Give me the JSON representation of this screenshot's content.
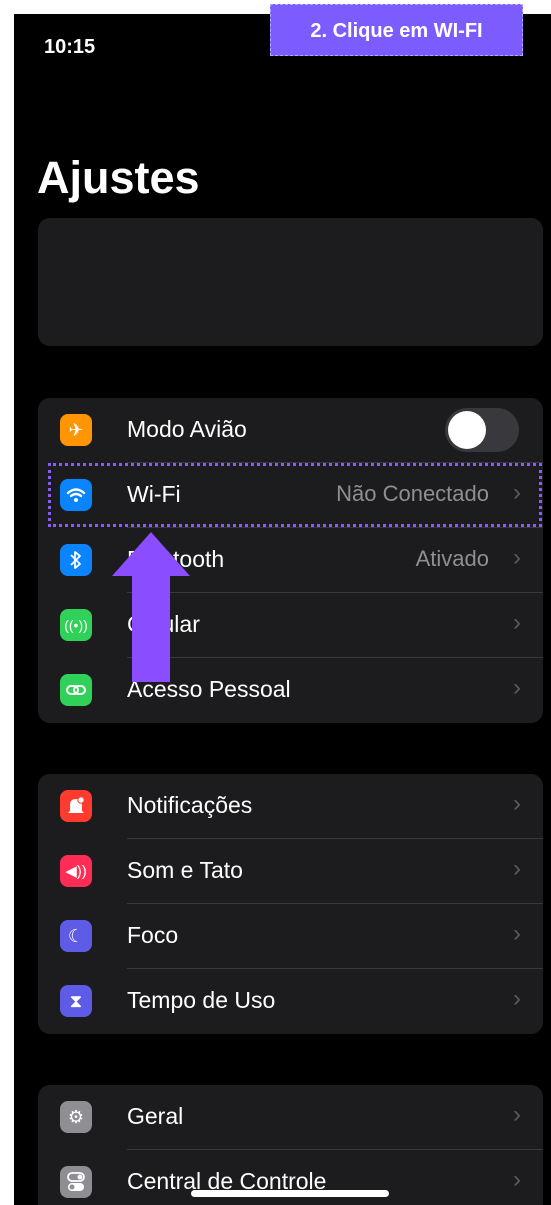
{
  "status": {
    "time": "10:15"
  },
  "callout": {
    "text": "2. Clique em WI-FI"
  },
  "page": {
    "title": "Ajustes"
  },
  "groups": [
    {
      "rows": [
        {
          "label": "Modo Avião",
          "value": "",
          "icon": "airplane-icon",
          "icon_color": "#ff9500",
          "toggle": "off"
        },
        {
          "label": "Wi-Fi",
          "value": "Não Conectado",
          "icon": "wifi-icon",
          "icon_color": "#0a84ff"
        },
        {
          "label": "Bluetooth",
          "value": "Ativado",
          "icon": "bluetooth-icon",
          "icon_color": "#0a84ff"
        },
        {
          "label": "Celular",
          "value": "",
          "icon": "antenna-icon",
          "icon_color": "#30d158"
        },
        {
          "label": "Acesso Pessoal",
          "value": "",
          "icon": "hotspot-icon",
          "icon_color": "#30d158"
        }
      ]
    },
    {
      "rows": [
        {
          "label": "Notificações",
          "value": "",
          "icon": "bell-icon",
          "icon_color": "#ff3b30"
        },
        {
          "label": "Som e Tato",
          "value": "",
          "icon": "speaker-icon",
          "icon_color": "#ff2d55"
        },
        {
          "label": "Foco",
          "value": "",
          "icon": "moon-icon",
          "icon_color": "#5e5ce6"
        },
        {
          "label": "Tempo de Uso",
          "value": "",
          "icon": "hourglass-icon",
          "icon_color": "#5e5ce6"
        }
      ]
    },
    {
      "rows": [
        {
          "label": "Geral",
          "value": "",
          "icon": "gear-icon",
          "icon_color": "#8e8e93"
        },
        {
          "label": "Central de Controle",
          "value": "",
          "icon": "control-center-icon",
          "icon_color": "#8e8e93"
        }
      ]
    }
  ],
  "colors": {
    "accent": "#7c5cff",
    "background": "#000000",
    "card": "#1c1c1e"
  }
}
